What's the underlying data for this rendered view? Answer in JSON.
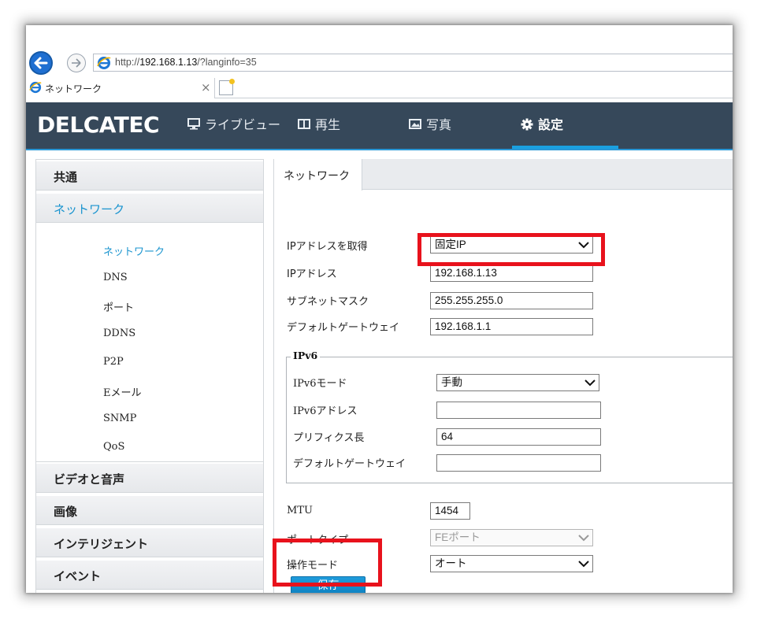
{
  "browser": {
    "url_prefix": "http://",
    "url_host": "192.168.1.13",
    "url_path": "/?langinfo=35",
    "tab_title": "ネットワーク",
    "tab_close": "×"
  },
  "header": {
    "logo": "DELCATEC",
    "nav": [
      {
        "label": "ライブビュー",
        "icon": "monitor-icon"
      },
      {
        "label": "再生",
        "icon": "film-icon"
      },
      {
        "label": "写真",
        "icon": "photo-icon"
      },
      {
        "label": "設定",
        "icon": "gear-icon",
        "active": true
      }
    ],
    "accent_color": "#1aa0e0",
    "bg_color": "#36485a"
  },
  "sidebar": {
    "groups": [
      "共通",
      "ネットワーク",
      "ビデオと音声",
      "画像",
      "インテリジェント",
      "イベント"
    ],
    "open_group": "ネットワーク",
    "sub_items": [
      "ネットワーク",
      "DNS",
      "ポート",
      "DDNS",
      "P2P",
      "Eメール",
      "SNMP",
      "QoS"
    ],
    "active_sub_item": "ネットワーク"
  },
  "content": {
    "tab": "ネットワーク",
    "ip_mode_label": "IPアドレスを取得",
    "ip_mode_value": "固定IP",
    "ip_label": "IPアドレス",
    "ip_value": "192.168.1.13",
    "subnet_label": "サブネットマスク",
    "subnet_value": "255.255.255.0",
    "gateway_label": "デフォルトゲートウェイ",
    "gateway_value": "192.168.1.1",
    "ipv6": {
      "legend": "IPv6",
      "mode_label": "IPv6モード",
      "mode_value": "手動",
      "addr_label": "IPv6アドレス",
      "addr_value": "",
      "prefix_label": "プリフィクス長",
      "prefix_value": "64",
      "gateway_label": "デフォルトゲートウェイ",
      "gateway_value": ""
    },
    "mtu_label": "MTU",
    "mtu_value": "1454",
    "port_type_label": "ポートタイプ",
    "port_type_value": "FEポート",
    "op_mode_label": "操作モード",
    "op_mode_value": "オート",
    "save_label": "保存"
  },
  "highlight_color": "#e8121c"
}
